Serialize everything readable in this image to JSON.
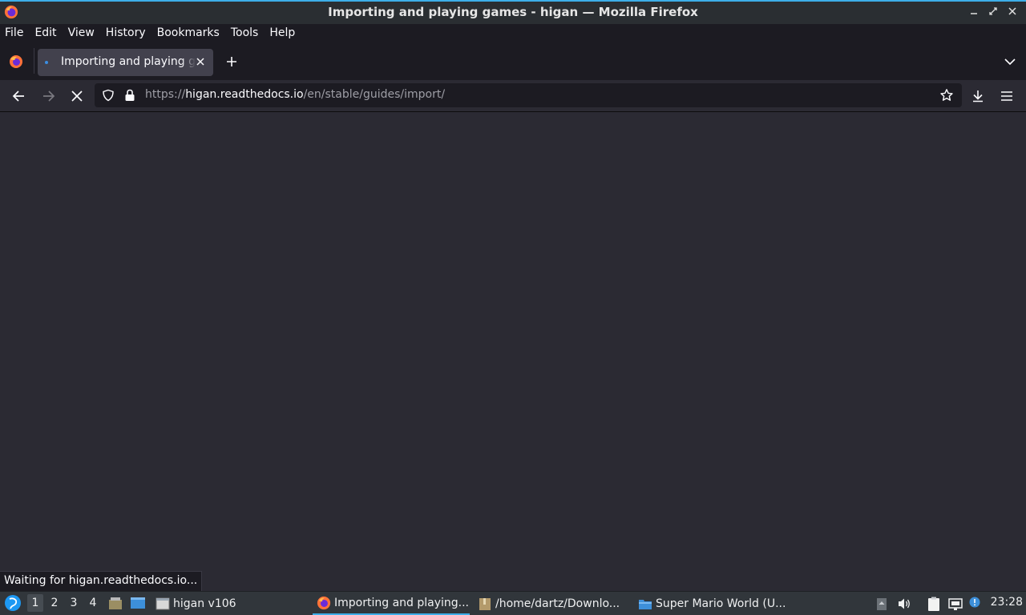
{
  "window": {
    "title": "Importing and playing games - higan — Mozilla Firefox"
  },
  "menubar": {
    "items": [
      "File",
      "Edit",
      "View",
      "History",
      "Bookmarks",
      "Tools",
      "Help"
    ]
  },
  "tabs": [
    {
      "title": "Importing and playing games - higan",
      "active": true,
      "loading": true
    }
  ],
  "navbar": {
    "url_prefix": "https://",
    "url_host": "higan.readthedocs.io",
    "url_path": "/en/stable/guides/import/"
  },
  "status": {
    "text": "Waiting for higan.readthedocs.io..."
  },
  "taskbar": {
    "workspaces": [
      "1",
      "2",
      "3",
      "4"
    ],
    "active_workspace": "1",
    "tasks": [
      {
        "label": "higan v106",
        "icon": "window-icon"
      },
      {
        "label": "Importing and playing...",
        "icon": "firefox-icon",
        "active": true
      },
      {
        "label": "/home/dartz/Downlo...",
        "icon": "archive-icon"
      },
      {
        "label": "Super Mario World (U...",
        "icon": "folder-icon"
      }
    ],
    "clock": "23:28"
  },
  "colors": {
    "accent": "#3daee9",
    "content_bg": "#2b2a33",
    "toolbar_bg": "#1c1b22"
  }
}
